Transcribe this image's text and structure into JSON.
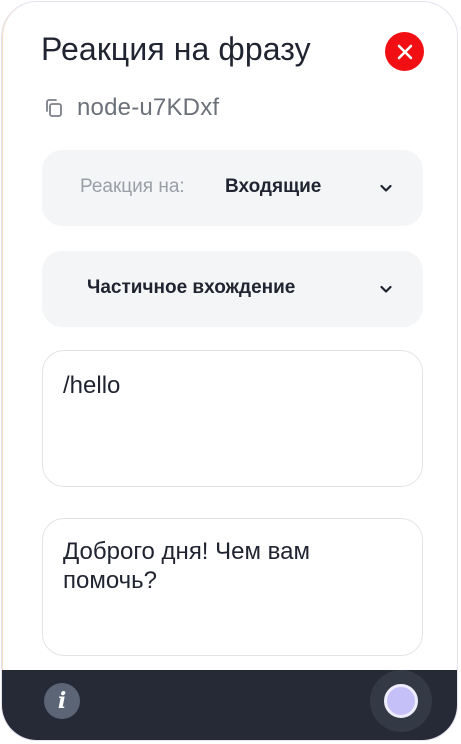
{
  "panel": {
    "title": "Реакция на фразу",
    "node_id": "node-u7KDxf"
  },
  "reaction_select": {
    "prefix": "Реакция на:",
    "value": "Входящие"
  },
  "match_select": {
    "value": "Частичное вхождение"
  },
  "phrase_field": {
    "value": "/hello"
  },
  "response_field": {
    "value": "Доброго дня! Чем вам помочь?"
  },
  "colors": {
    "close_button": "#f20f13",
    "footer_bg": "#262a36",
    "record_accent": "#c6c0f8"
  },
  "icons": {
    "close": "close-icon",
    "copy": "copy-icon",
    "chevron": "chevron-down-icon",
    "info": "info-icon",
    "record": "record-icon"
  }
}
